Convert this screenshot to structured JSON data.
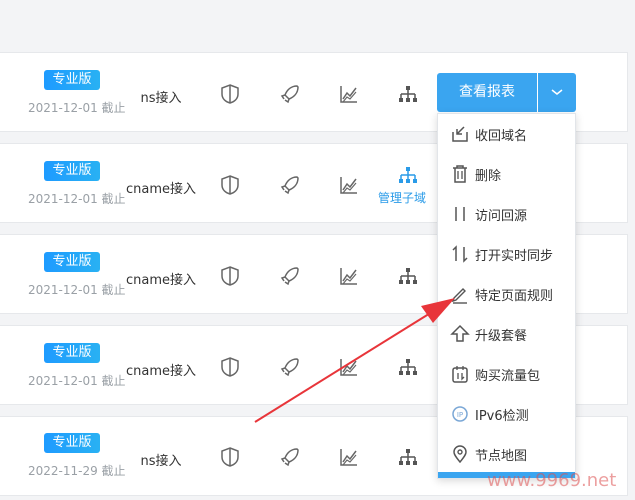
{
  "rows": [
    {
      "plan": "专业版",
      "expire": "2021-12-01 截止",
      "access": "ns接入"
    },
    {
      "plan": "专业版",
      "expire": "2021-12-01 截止",
      "access": "cname接入",
      "subdomain_label": "管理子域"
    },
    {
      "plan": "专业版",
      "expire": "2021-12-01 截止",
      "access": "cname接入"
    },
    {
      "plan": "专业版",
      "expire": "2021-12-01 截止",
      "access": "cname接入"
    },
    {
      "plan": "专业版",
      "expire": "2022-11-29 截止",
      "access": "ns接入"
    }
  ],
  "report_button": {
    "label": "查看报表"
  },
  "dropdown": {
    "items": [
      {
        "label": "收回域名",
        "icon": "reclaim-icon"
      },
      {
        "label": "删除",
        "icon": "trash-icon"
      },
      {
        "label": "访问回源",
        "icon": "origin-icon"
      },
      {
        "label": "打开实时同步",
        "icon": "sync-icon"
      },
      {
        "label": "特定页面规则",
        "icon": "pencil-icon"
      },
      {
        "label": "升级套餐",
        "icon": "upgrade-icon"
      },
      {
        "label": "购买流量包",
        "icon": "traffic-icon"
      },
      {
        "label": "IPv6检测",
        "icon": "ipv6-icon"
      },
      {
        "label": "节点地图",
        "icon": "location-icon"
      }
    ]
  },
  "watermark": "www.9969.net",
  "colors": {
    "accent": "#3aa5f0",
    "badge": "#1e9bff",
    "annotation_arrow": "#e8353a"
  }
}
